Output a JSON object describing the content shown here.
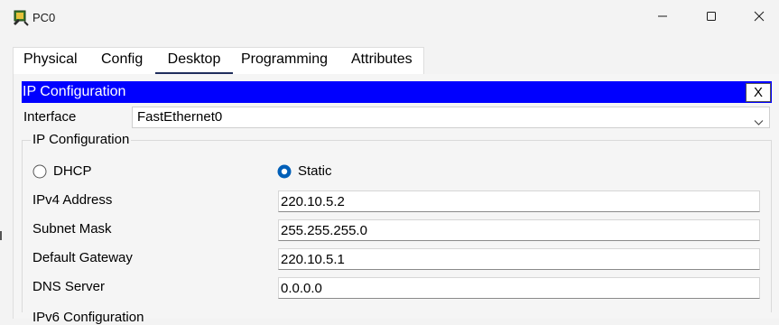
{
  "window": {
    "title": "PC0",
    "icon": "pc-icon"
  },
  "tabs": [
    {
      "label": "Physical",
      "active": false
    },
    {
      "label": "Config",
      "active": false
    },
    {
      "label": "Desktop",
      "active": true
    },
    {
      "label": "Programming",
      "active": false
    },
    {
      "label": "Attributes",
      "active": false
    }
  ],
  "ip_config": {
    "header_title": "IP Configuration",
    "close_label": "X",
    "interface_label": "Interface",
    "interface_value": "FastEthernet0",
    "group_title": "IP Configuration",
    "dhcp_label": "DHCP",
    "static_label": "Static",
    "mode_selected": "Static",
    "fields": {
      "ipv4_label": "IPv4 Address",
      "ipv4_value": "220.10.5.2",
      "mask_label": "Subnet Mask",
      "mask_value": "255.255.255.0",
      "gateway_label": "Default Gateway",
      "gateway_value": "220.10.5.1",
      "dns_label": "DNS Server",
      "dns_value": "0.0.0.0"
    },
    "ipv6_group_title": "IPv6 Configuration"
  },
  "colors": {
    "header_bar": "#0000ff",
    "radio_selected": "#005fb8",
    "active_tab_underline": "#1f2d5c"
  }
}
